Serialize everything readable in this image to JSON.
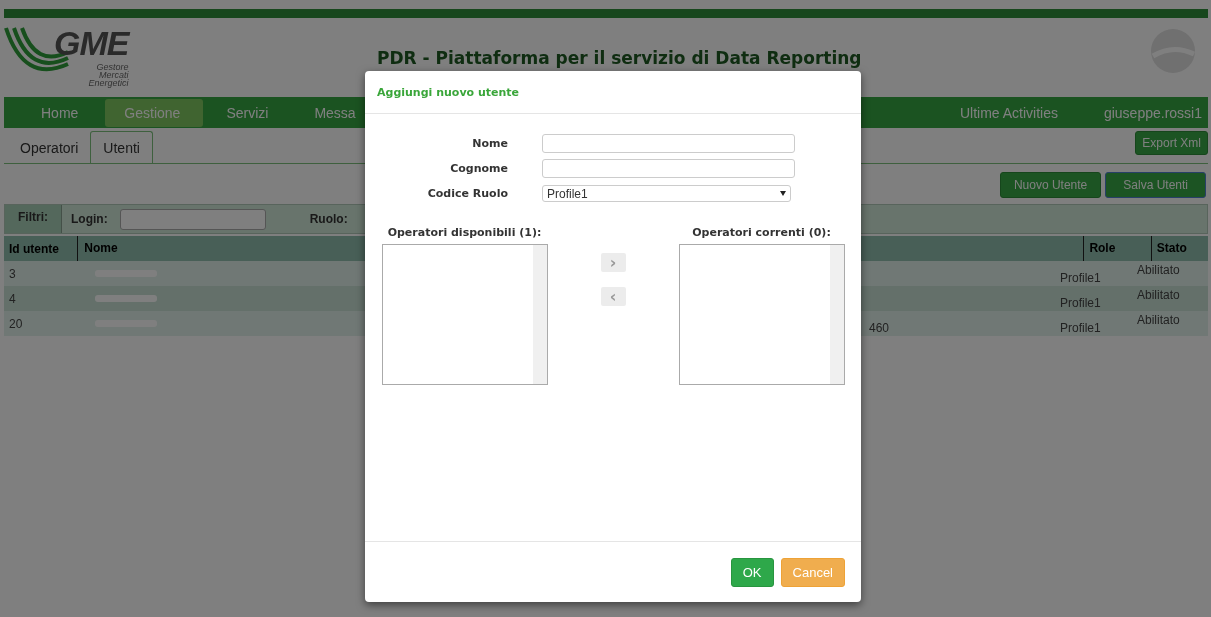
{
  "logo": {
    "name": "GME",
    "subtitle": [
      "Gestore",
      "Mercati",
      "Energetici"
    ]
  },
  "header": {
    "title": "PDR - Piattaforma per il servizio di Data Reporting"
  },
  "nav": {
    "items": [
      {
        "label": "Home",
        "selected": false
      },
      {
        "label": "Gestione",
        "selected": true
      },
      {
        "label": "Servizi",
        "selected": false
      },
      {
        "label": "Messa",
        "selected": false
      }
    ],
    "right": [
      "Ultime Activities",
      "giuseppe.rossi1"
    ]
  },
  "subtabs": [
    {
      "label": "Operatori",
      "selected": false
    },
    {
      "label": "Utenti",
      "selected": true
    }
  ],
  "export_button": "Export Xml",
  "actions": [
    "Nuovo Utente",
    "Salva Utenti"
  ],
  "filters": {
    "title": "Filtri:",
    "login_label": "Login:",
    "role_label": "Ruolo:"
  },
  "table": {
    "columns": [
      "Id utente",
      "Nome",
      "Role",
      "Stato"
    ],
    "rows": [
      {
        "id": "3",
        "name_redacted": true,
        "role": "Profile1",
        "stato": "Abilitato"
      },
      {
        "id": "4",
        "name_redacted": true,
        "role": "Profile1",
        "stato": "Abilitato"
      },
      {
        "id": "20",
        "name_redacted": true,
        "column_3": "460",
        "role": "Profile1",
        "stato": "Abilitato"
      }
    ]
  },
  "modal": {
    "title": "Aggiungi nuovo utente",
    "fields": [
      {
        "label": "Nome",
        "kind": "text"
      },
      {
        "label": "Cognome",
        "kind": "text"
      },
      {
        "label": "Codice Ruolo",
        "kind": "select",
        "value": "Profile1"
      }
    ],
    "available": {
      "title": "Operatori disponibili (1):"
    },
    "current": {
      "title": "Operatori correnti (0):"
    },
    "move_right": "›",
    "move_left": "‹",
    "ok": "OK",
    "cancel": "Cancel"
  }
}
